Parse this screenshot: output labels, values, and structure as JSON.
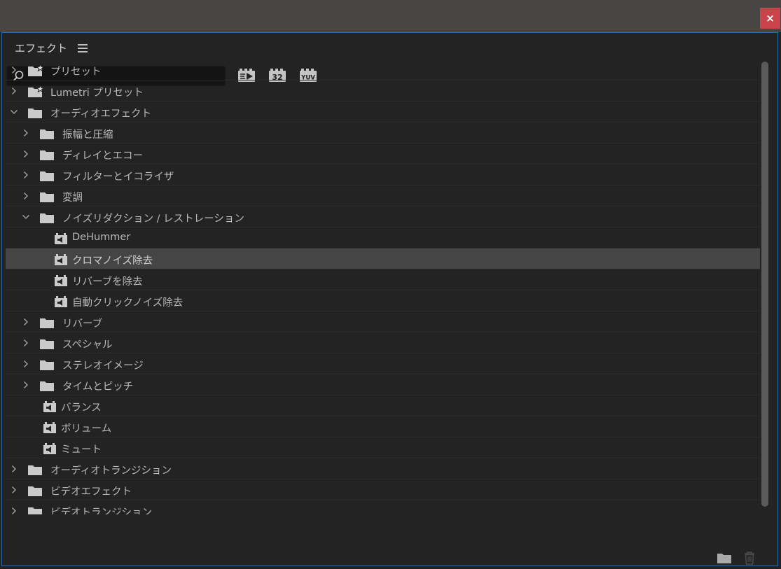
{
  "window": {
    "close_label": "×"
  },
  "panel": {
    "title": "エフェクト"
  },
  "search": {
    "value": "",
    "placeholder": ""
  },
  "filters": [
    {
      "label": "",
      "icon": "accelerated-effects-icon"
    },
    {
      "label": "32",
      "icon": "32bit-color-effects-icon"
    },
    {
      "label": "YUV",
      "icon": "yuv-effects-icon"
    }
  ],
  "tree": [
    {
      "label": "プリセット",
      "level": 0,
      "kind": "preset-folder",
      "expand": "collapsed"
    },
    {
      "label": "Lumetri プリセット",
      "level": 0,
      "kind": "preset-folder",
      "expand": "collapsed"
    },
    {
      "label": "オーディオエフェクト",
      "level": 0,
      "kind": "folder",
      "expand": "expanded"
    },
    {
      "label": "振幅と圧縮",
      "level": 1,
      "kind": "folder",
      "expand": "collapsed"
    },
    {
      "label": "ディレイとエコー",
      "level": 1,
      "kind": "folder",
      "expand": "collapsed"
    },
    {
      "label": "フィルターとイコライザ",
      "level": 1,
      "kind": "folder",
      "expand": "collapsed"
    },
    {
      "label": "変調",
      "level": 1,
      "kind": "folder",
      "expand": "collapsed"
    },
    {
      "label": "ノイズリダクション / レストレーション",
      "level": 1,
      "kind": "folder",
      "expand": "expanded"
    },
    {
      "label": "DeHummer",
      "level": 2,
      "kind": "effect",
      "expand": "none"
    },
    {
      "label": "クロマノイズ除去",
      "level": 2,
      "kind": "effect",
      "expand": "none",
      "selected": true
    },
    {
      "label": "リバーブを除去",
      "level": 2,
      "kind": "effect",
      "expand": "none"
    },
    {
      "label": "自動クリックノイズ除去",
      "level": 2,
      "kind": "effect",
      "expand": "none"
    },
    {
      "label": "リバーブ",
      "level": 1,
      "kind": "folder",
      "expand": "collapsed"
    },
    {
      "label": "スペシャル",
      "level": 1,
      "kind": "folder",
      "expand": "collapsed"
    },
    {
      "label": "ステレオイメージ",
      "level": 1,
      "kind": "folder",
      "expand": "collapsed"
    },
    {
      "label": "タイムとピッチ",
      "level": 1,
      "kind": "folder",
      "expand": "collapsed"
    },
    {
      "label": "バランス",
      "level": 1,
      "kind": "effect",
      "expand": "none"
    },
    {
      "label": "ボリューム",
      "level": 1,
      "kind": "effect",
      "expand": "none"
    },
    {
      "label": "ミュート",
      "level": 1,
      "kind": "effect",
      "expand": "none"
    },
    {
      "label": "オーディオトランジション",
      "level": 0,
      "kind": "folder",
      "expand": "collapsed"
    },
    {
      "label": "ビデオエフェクト",
      "level": 0,
      "kind": "folder",
      "expand": "collapsed"
    },
    {
      "label": "ビデオトランジション",
      "level": 0,
      "kind": "folder",
      "expand": "collapsed"
    }
  ],
  "footer": {
    "new_bin_icon": "new-bin-icon",
    "delete_icon": "trash-icon"
  },
  "colors": {
    "titlebar": "#474645",
    "close": "#c8434a",
    "panel_border": "#2e6aa6",
    "selected_row": "#454545",
    "icon": "#cacaca"
  }
}
